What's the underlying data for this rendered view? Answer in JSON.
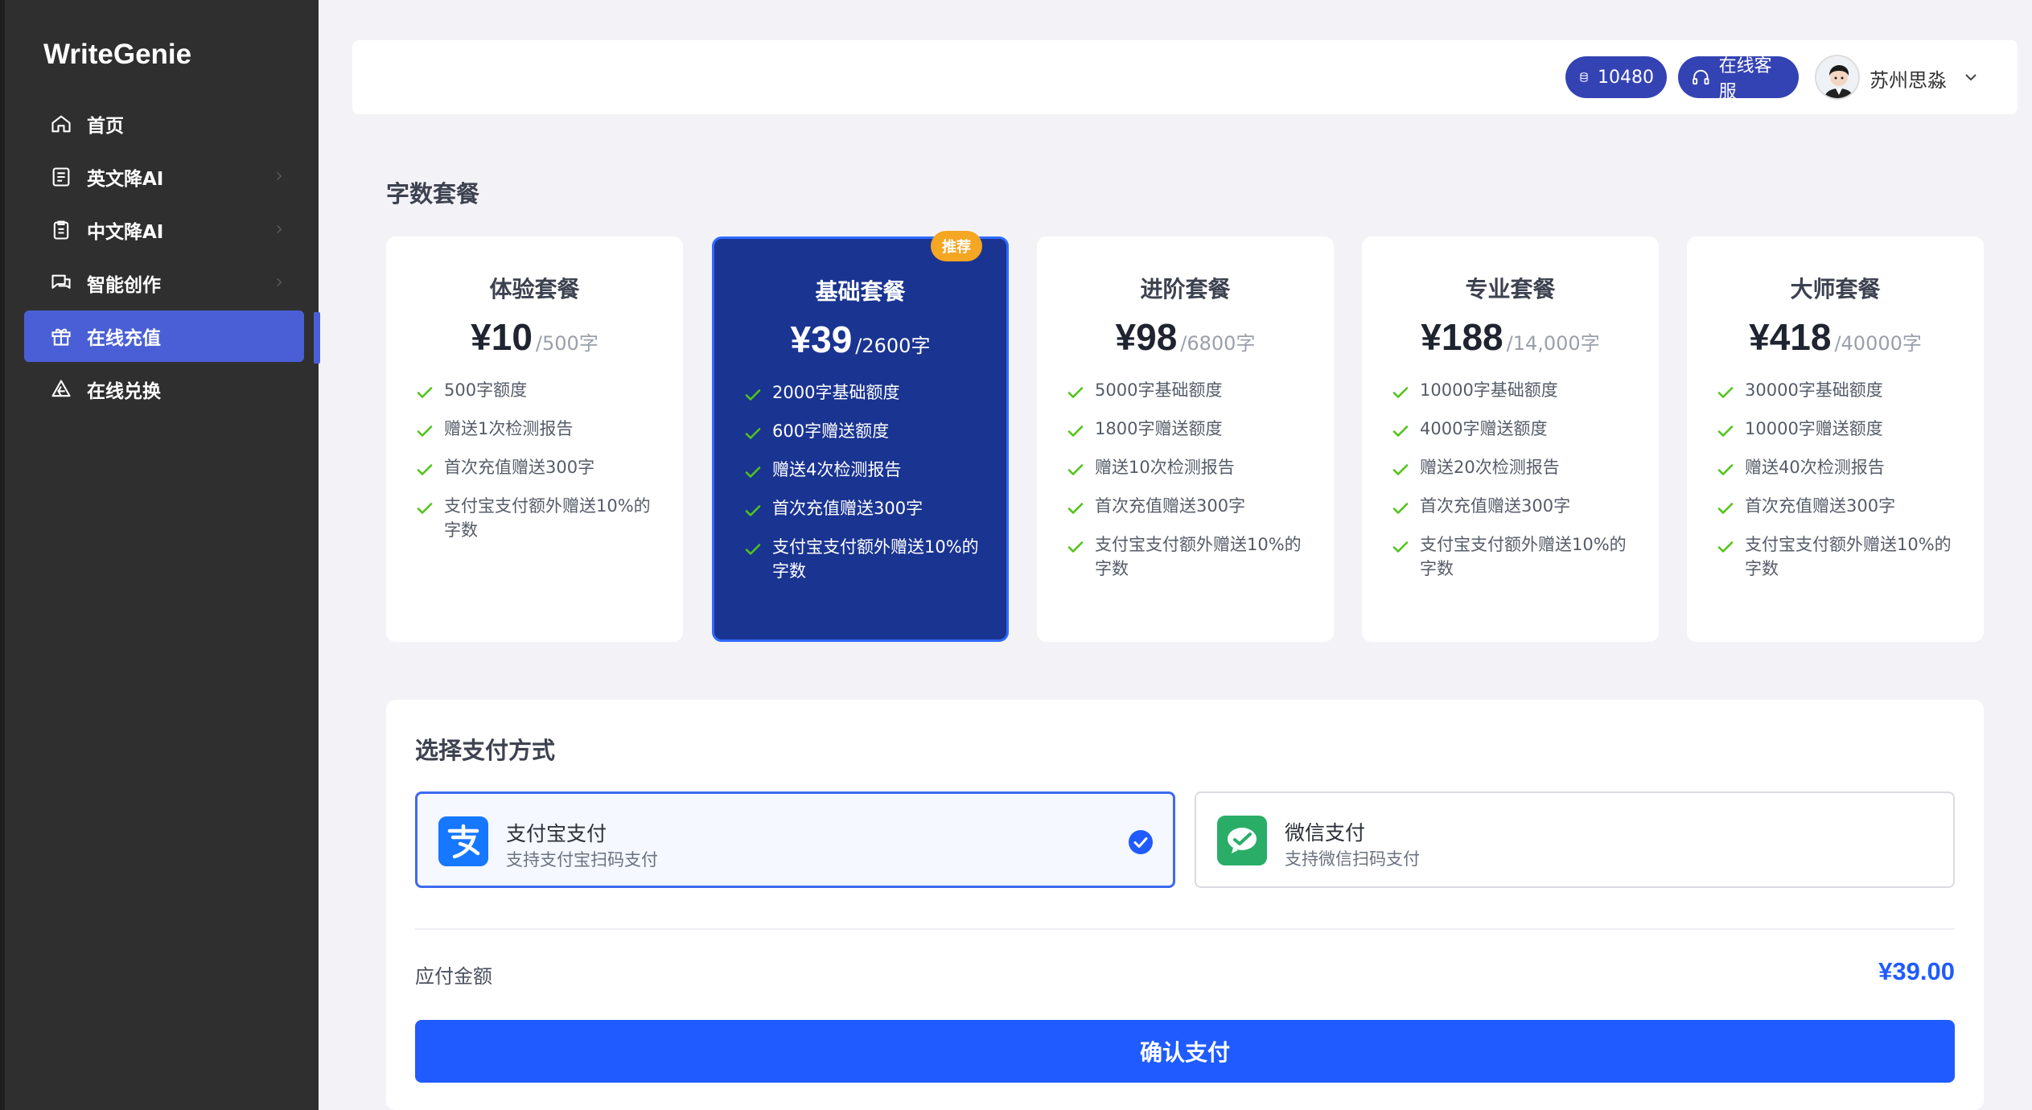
{
  "app": {
    "name": "WriteGenie"
  },
  "sidebar": {
    "items": [
      {
        "label": "首页",
        "icon": "home-icon",
        "has_arrow": false,
        "active": false
      },
      {
        "label": "英文降AI",
        "icon": "document-icon",
        "has_arrow": true,
        "active": false
      },
      {
        "label": "中文降AI",
        "icon": "clipboard-icon",
        "has_arrow": true,
        "active": false
      },
      {
        "label": "智能创作",
        "icon": "chat-icon",
        "has_arrow": true,
        "active": false
      },
      {
        "label": "在线充值",
        "icon": "gift-icon",
        "has_arrow": false,
        "active": true
      },
      {
        "label": "在线兑换",
        "icon": "exchange-icon",
        "has_arrow": false,
        "active": false
      }
    ]
  },
  "header": {
    "credits": "10480",
    "service_label": "在线客服",
    "user_name": "苏州思淼"
  },
  "plans_section": {
    "title": "字数套餐",
    "plans": [
      {
        "name": "体验套餐",
        "price": "¥10",
        "unit": "/500字",
        "featured": false,
        "features": [
          "500字额度",
          "赠送1次检测报告",
          "首次充值赠送300字",
          "支付宝支付额外赠送10%的字数"
        ]
      },
      {
        "name": "基础套餐",
        "price": "¥39",
        "unit": "/2600字",
        "featured": true,
        "badge": "推荐",
        "features": [
          "2000字基础额度",
          "600字赠送额度",
          "赠送4次检测报告",
          "首次充值赠送300字",
          "支付宝支付额外赠送10%的字数"
        ]
      },
      {
        "name": "进阶套餐",
        "price": "¥98",
        "unit": "/6800字",
        "featured": false,
        "features": [
          "5000字基础额度",
          "1800字赠送额度",
          "赠送10次检测报告",
          "首次充值赠送300字",
          "支付宝支付额外赠送10%的字数"
        ]
      },
      {
        "name": "专业套餐",
        "price": "¥188",
        "unit": "/14,000字",
        "featured": false,
        "features": [
          "10000字基础额度",
          "4000字赠送额度",
          "赠送20次检测报告",
          "首次充值赠送300字",
          "支付宝支付额外赠送10%的字数"
        ]
      },
      {
        "name": "大师套餐",
        "price": "¥418",
        "unit": "/40000字",
        "featured": false,
        "features": [
          "30000字基础额度",
          "10000字赠送额度",
          "赠送40次检测报告",
          "首次充值赠送300字",
          "支付宝支付额外赠送10%的字数"
        ]
      }
    ]
  },
  "payment": {
    "title": "选择支付方式",
    "options": [
      {
        "name": "支付宝支付",
        "desc": "支持支付宝扫码支付",
        "icon": "alipay-icon",
        "selected": true
      },
      {
        "name": "微信支付",
        "desc": "支持微信扫码支付",
        "icon": "wechat-icon",
        "selected": false
      }
    ],
    "amount_label": "应付金额",
    "amount": "¥39.00",
    "confirm_label": "确认支付"
  },
  "colors": {
    "sidebar_bg": "#2f2f2f",
    "accent": "#4a5fd6",
    "featured_bg": "#1a3491",
    "primary_button": "#1f5bff",
    "check_green": "#52c41a",
    "badge": "#f5a623"
  }
}
